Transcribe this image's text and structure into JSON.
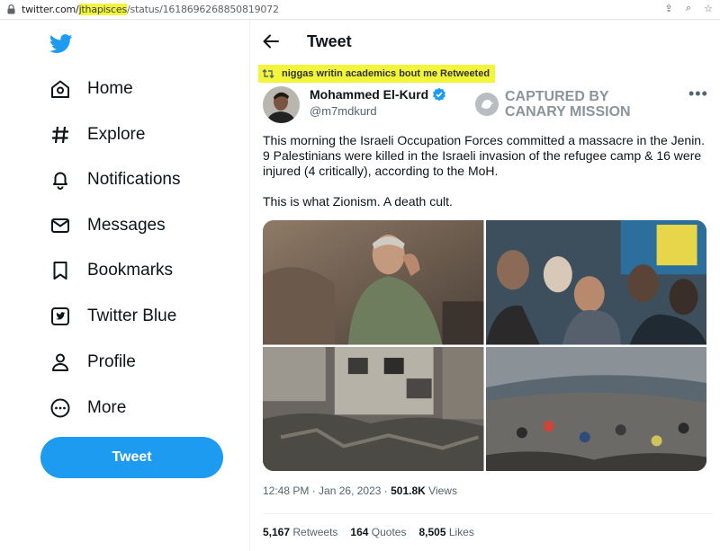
{
  "browser": {
    "url_prefix": "twitter.com/",
    "url_highlight": "jthapisces",
    "url_suffix": "/status/1618696268850819072"
  },
  "sidebar": {
    "items": [
      {
        "label": "Home",
        "icon": "home-icon"
      },
      {
        "label": "Explore",
        "icon": "hashtag-icon"
      },
      {
        "label": "Notifications",
        "icon": "bell-icon"
      },
      {
        "label": "Messages",
        "icon": "envelope-icon"
      },
      {
        "label": "Bookmarks",
        "icon": "bookmark-icon"
      },
      {
        "label": "Twitter Blue",
        "icon": "twitter-blue-icon"
      },
      {
        "label": "Profile",
        "icon": "person-icon"
      },
      {
        "label": "More",
        "icon": "more-circle-icon"
      }
    ],
    "tweet_button": "Tweet"
  },
  "header": {
    "title": "Tweet"
  },
  "retweet_line": "niggas writin academics bout me Retweeted",
  "tweet": {
    "author_name": "Mohammed El-Kurd",
    "author_handle": "@m7mdkurd",
    "watermark_line1": "CAPTURED BY",
    "watermark_line2": "CANARY MISSION",
    "text_p1": "This morning the Israeli Occupation Forces committed a massacre in the Jenin. 9 Palestinians were killed in the Israeli invasion of the refugee camp & 16 were injured (4 critically), according to the MoH.",
    "text_p2": "This is what Zionism. A death cult.",
    "time": "12:48 PM",
    "date": "Jan 26, 2023",
    "views_count": "501.8K",
    "views_label": "Views",
    "retweets_count": "5,167",
    "retweets_label": "Retweets",
    "quotes_count": "164",
    "quotes_label": "Quotes",
    "likes_count": "8,505",
    "likes_label": "Likes"
  },
  "colors": {
    "accent": "#1d9bf0",
    "highlight": "#f3f53a",
    "secondary_text": "#536471"
  }
}
